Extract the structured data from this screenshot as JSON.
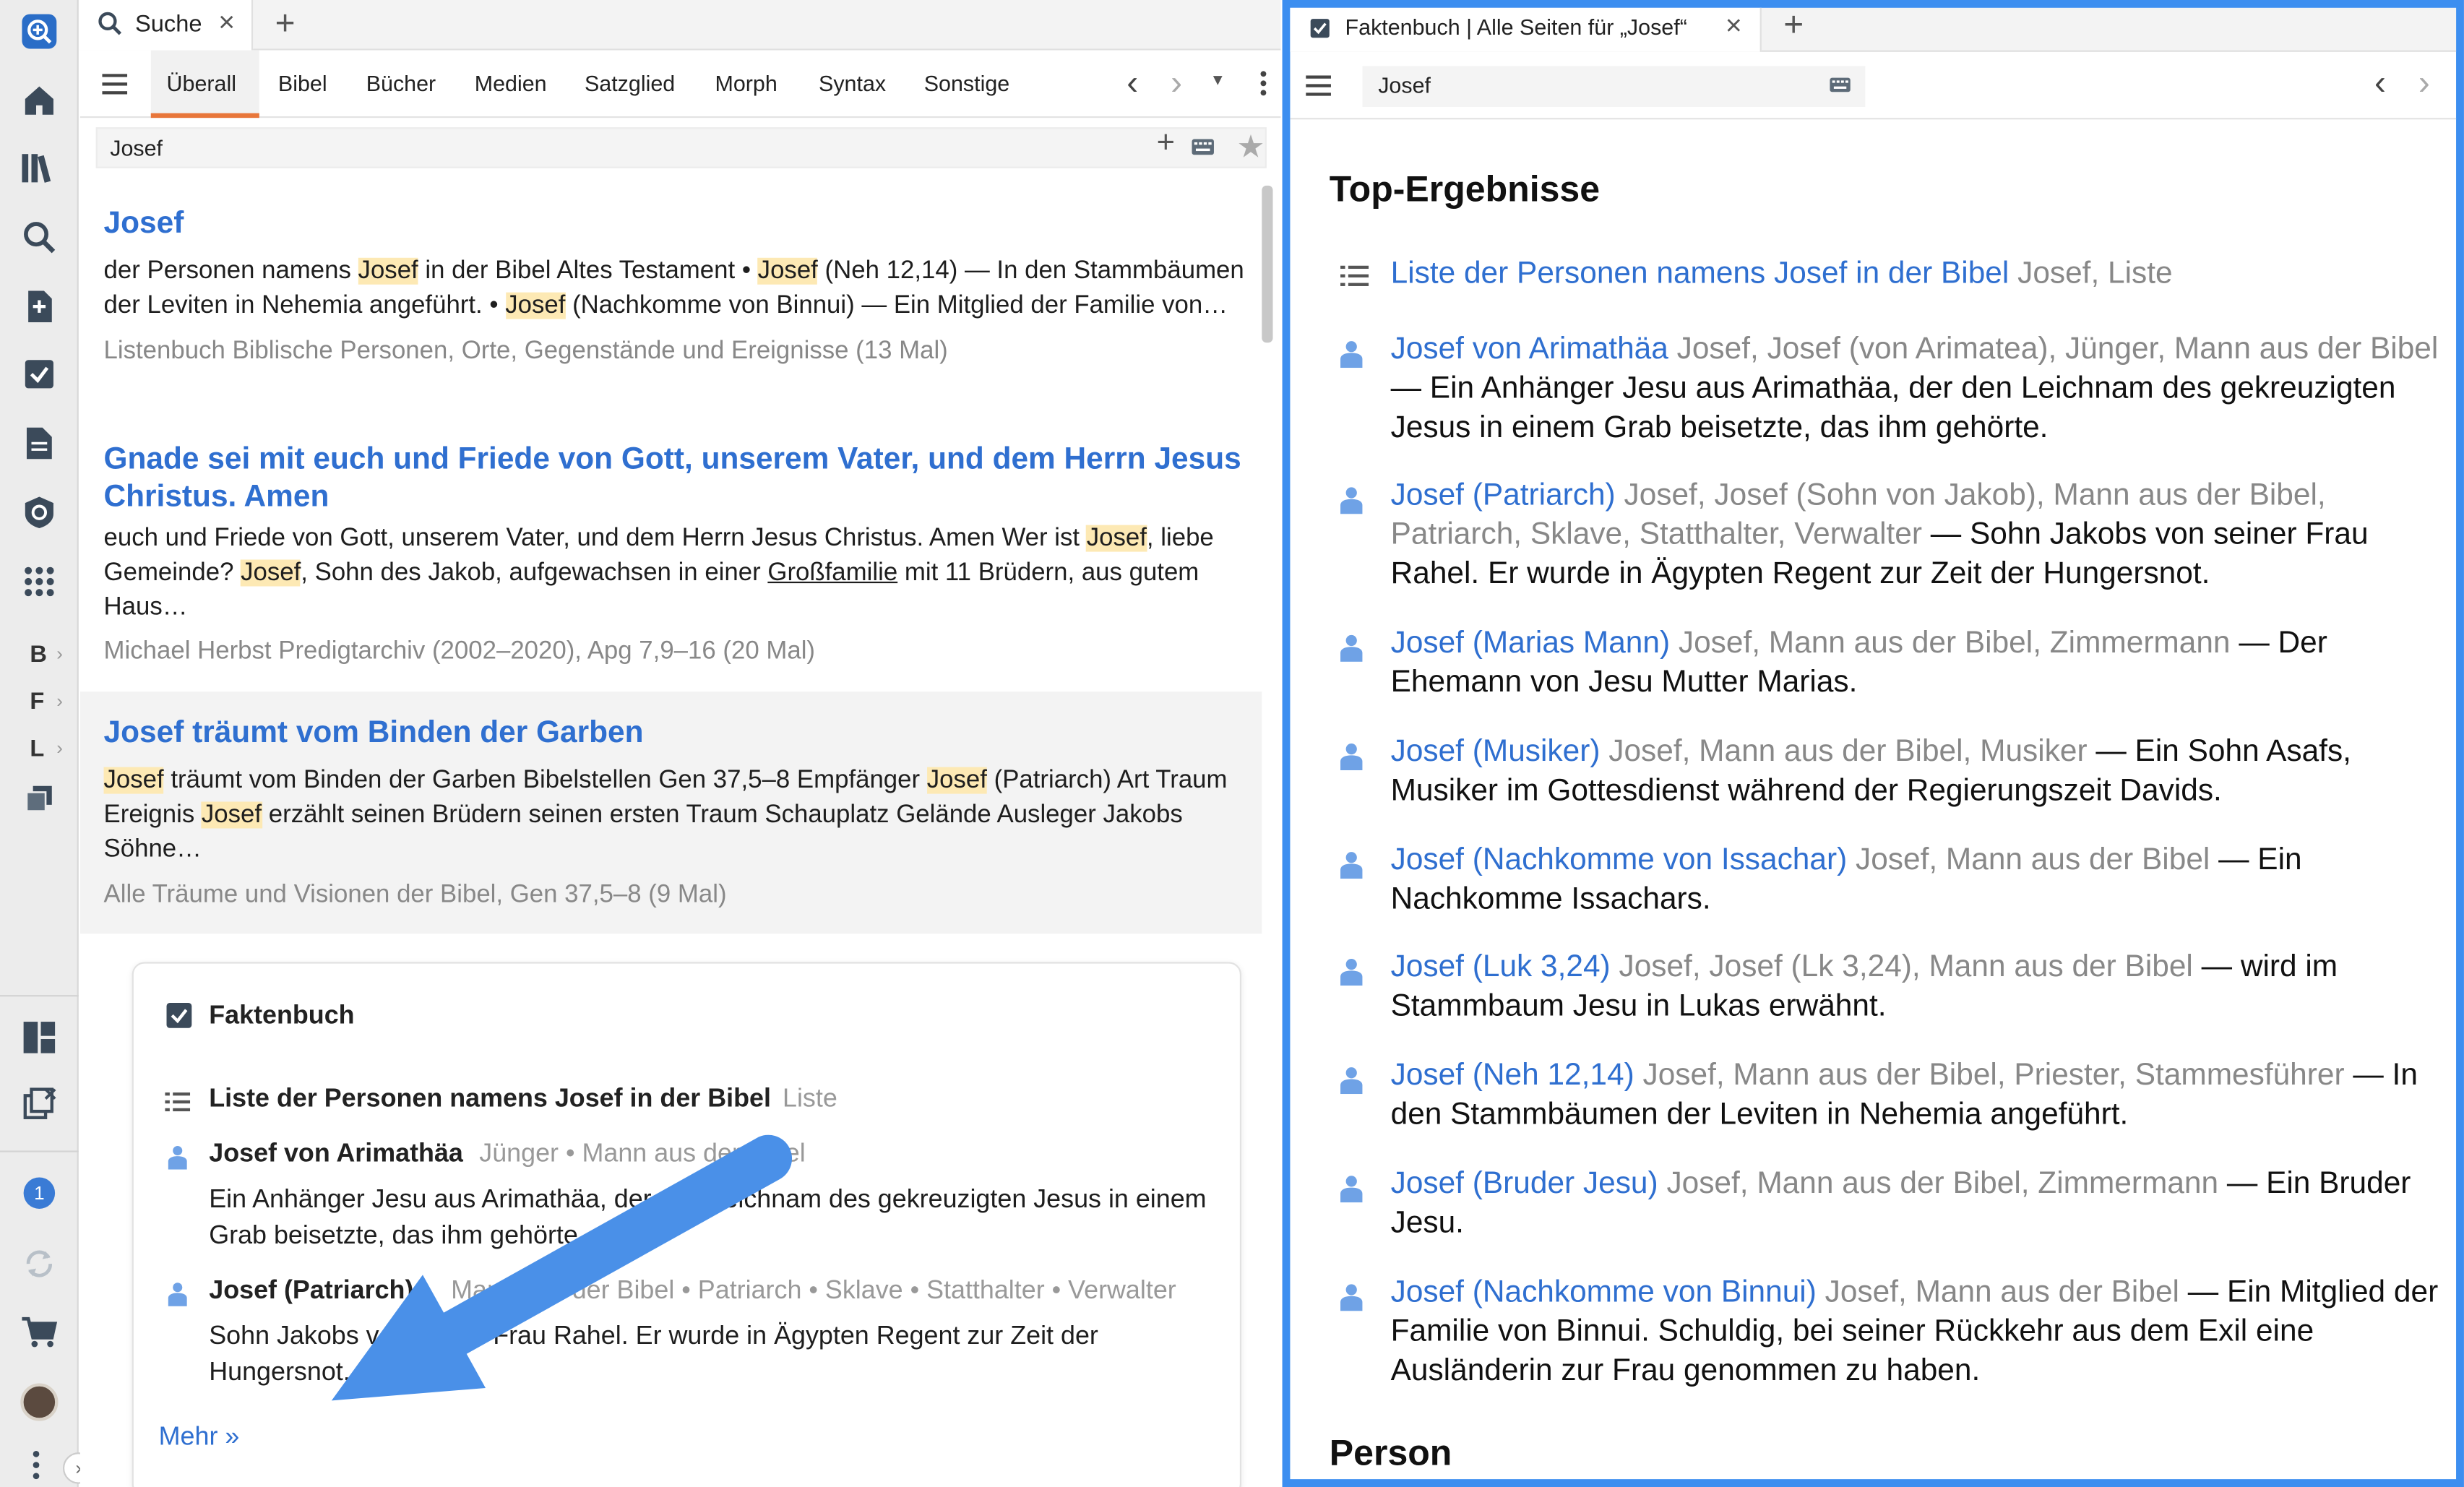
{
  "left_tab": {
    "title": "Suche"
  },
  "right_tab": {
    "title": "Faktenbuch | Alle Seiten für „Josef“"
  },
  "nav_tabs": [
    "Überall",
    "Bibel",
    "Bücher",
    "Medien",
    "Satzglied",
    "Morph",
    "Syntax",
    "Sonstige"
  ],
  "search": {
    "query": "Josef"
  },
  "sidebar": {
    "letters": [
      "B",
      "F",
      "L"
    ],
    "badge": "1"
  },
  "results": [
    {
      "title": "Josef",
      "text_parts": [
        {
          "t": "der Personen namens "
        },
        {
          "t": "Josef",
          "h": true
        },
        {
          "t": " in der Bibel Altes Testament • "
        },
        {
          "t": "Josef",
          "h": true
        },
        {
          "t": " (Neh 12,14) — In den Stammbäumen der Leviten in Nehemia angeführt. • "
        },
        {
          "t": "Josef",
          "h": true
        },
        {
          "t": " (Nachkomme von Binnui) — Ein Mitglied der Familie von…"
        }
      ],
      "source": "Listenbuch Biblische Personen, Orte, Gegenstände und Ereignisse (13 Mal)"
    },
    {
      "title": "Gnade sei mit euch und Friede von Gott, unserem Vater, und dem Herrn Jesus Christus. Amen",
      "text_parts": [
        {
          "t": "euch und Friede von Gott, unserem Vater, und dem Herrn Jesus Christus. Amen Wer ist "
        },
        {
          "t": "Josef",
          "h": true
        },
        {
          "t": ", liebe Gemeinde? "
        },
        {
          "t": "Josef",
          "h": true
        },
        {
          "t": ", Sohn des Jakob, aufgewachsen in einer "
        },
        {
          "t": "Großfamilie",
          "u": true
        },
        {
          "t": " mit 11 Brüdern, aus gutem Haus…"
        }
      ],
      "source": "Michael Herbst Predigtarchiv (2002–2020), Apg 7,9–16 (20 Mal)"
    },
    {
      "title": "Josef träumt vom Binden der Garben",
      "text_parts": [
        {
          "t": "Josef",
          "h": true
        },
        {
          "t": " träumt vom Binden der Garben Bibelstellen Gen 37,5–8 Empfänger "
        },
        {
          "t": "Josef",
          "h": true
        },
        {
          "t": " (Patriarch) Art Traum Ereignis "
        },
        {
          "t": "Josef",
          "h": true
        },
        {
          "t": " erzählt seinen Brüdern seinen ersten Traum Schauplatz Gelände Ausleger Jakobs Söhne…"
        }
      ],
      "source": "Alle Träume und Visionen der Bibel, Gen 37,5–8 (9 Mal)"
    }
  ],
  "faktenbuch_card": {
    "heading": "Faktenbuch",
    "list_title": "Liste der Personen namens Josef in der Bibel",
    "list_tag": "Liste",
    "entries": [
      {
        "name": "Josef von Arimathäa",
        "tags": "Jünger • Mann aus der Bibel",
        "desc": "Ein Anhänger Jesu aus Arimathäa, der den Leichnam des gekreuzigten Jesus in einem Grab beisetzte, das ihm gehörte."
      },
      {
        "name": "Josef (Patriarch)",
        "tags": "Mann aus der Bibel • Patriarch • Sklave • Statthalter • Verwalter",
        "desc": "Sohn Jakobs von seiner Frau Rahel. Er wurde in Ägypten Regent zur Zeit der Hungersnot."
      }
    ],
    "more": "Mehr »"
  },
  "right_panel": {
    "query": "Josef",
    "section": "Top-Ergebnisse",
    "section2": "Person",
    "list_entry": {
      "link": "Liste der Personen namens Josef in der Bibel",
      "meta": "Josef, Liste"
    },
    "items": [
      {
        "link": "Josef von Arimathäa",
        "meta": "Josef, Josef (von Arimatea), Jünger, Mann aus der Bibel",
        "desc": " — Ein Anhänger Jesu aus Arimathäa, der den Leichnam des gekreuzigten Jesus in einem Grab beisetzte, das ihm gehörte."
      },
      {
        "link": "Josef (Patriarch)",
        "meta": "Josef, Josef (Sohn von Jakob), Mann aus der Bibel, Patriarch, Sklave, Statthalter, Verwalter",
        "desc": " — Sohn Jakobs von seiner Frau Rahel. Er wurde in Ägypten Regent zur Zeit der Hungersnot."
      },
      {
        "link": "Josef (Marias Mann)",
        "meta": "Josef, Mann aus der Bibel, Zimmermann",
        "desc": " — Der Ehemann von Jesu Mutter Marias."
      },
      {
        "link": "Josef (Musiker)",
        "meta": "Josef, Mann aus der Bibel, Musiker",
        "desc": " — Ein Sohn Asafs, Musiker im Gottesdienst während der Regierungszeit Davids."
      },
      {
        "link": "Josef (Nachkomme von Issachar)",
        "meta": "Josef, Mann aus der Bibel",
        "desc": " — Ein Nachkomme Issachars."
      },
      {
        "link": "Josef (Luk 3,24)",
        "meta": "Josef, Josef (Lk 3,24), Mann aus der Bibel",
        "desc": " — wird im Stammbaum Jesu in Lukas erwähnt."
      },
      {
        "link": "Josef (Neh 12,14)",
        "meta": "Josef, Mann aus der Bibel, Priester, Stammesführer",
        "desc": " — In den Stammbäumen der Leviten in Nehemia angeführt."
      },
      {
        "link": "Josef (Bruder Jesu)",
        "meta": "Josef, Mann aus der Bibel, Zimmermann",
        "desc": " — Ein Bruder Jesu."
      },
      {
        "link": "Josef (Nachkomme von Binnui)",
        "meta": "Josef, Mann aus der Bibel",
        "desc": " — Ein Mitglied der Familie von Binnui. Schuldig, bei seiner Rückkehr aus dem Exil eine Ausländerin zur Frau genommen zu haben."
      }
    ]
  },
  "colors": {
    "accent": "#2f6fd0",
    "highlight": "#fde9b4",
    "active_tab": "#e8763a",
    "panel_border": "#3c8ef0",
    "annotation_arrow": "#4a90e8"
  }
}
